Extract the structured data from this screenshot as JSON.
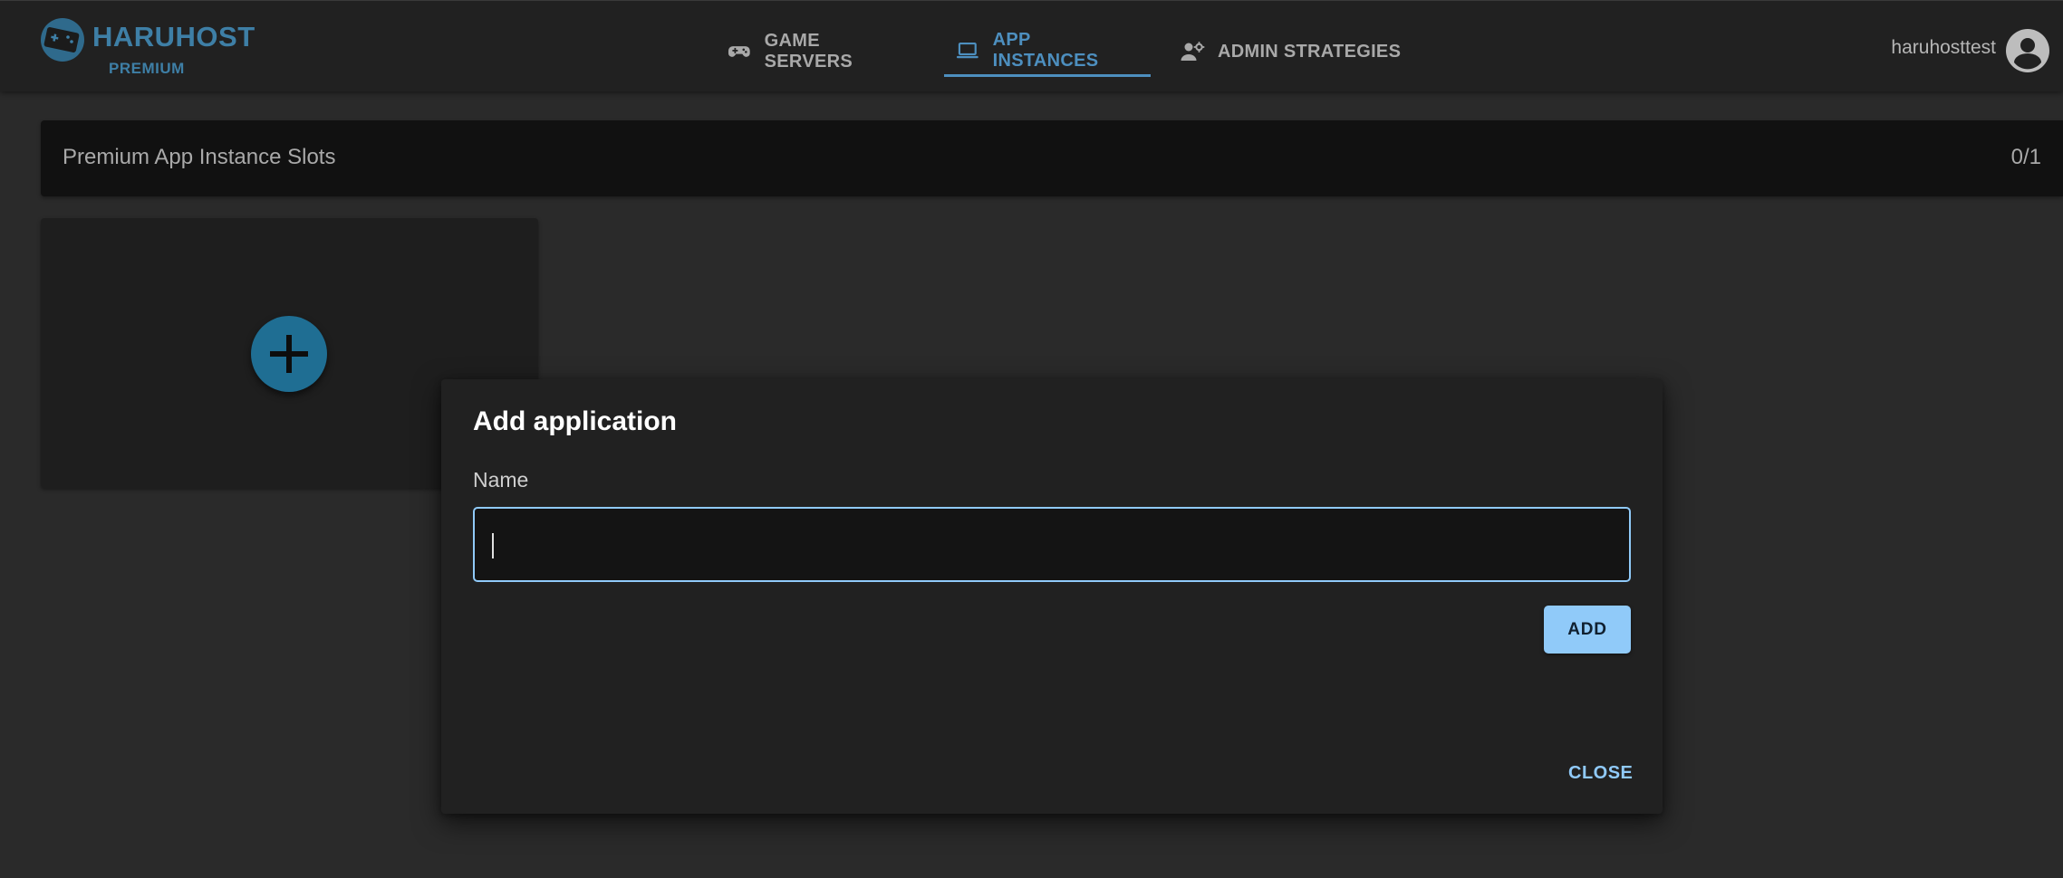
{
  "brand": {
    "name": "HARUHOST",
    "tier": "PREMIUM",
    "logo_icon": "gamepad-logo-icon",
    "color": "#3e7fa6"
  },
  "nav": {
    "tabs": [
      {
        "label": "GAME SERVERS",
        "icon": "gamepad-icon",
        "active": false
      },
      {
        "label": "APP INSTANCES",
        "icon": "laptop-icon",
        "active": true
      },
      {
        "label": "ADMIN STRATEGIES",
        "icon": "user-cog-icon",
        "active": false
      }
    ],
    "active_color": "#4d8fbf"
  },
  "user": {
    "name": "haruhosttest",
    "icon": "account-circle-icon"
  },
  "slots": {
    "title": "Premium App Instance Slots",
    "count": "0/1"
  },
  "add_card": {
    "icon": "plus-icon",
    "fab_color": "#1f6e93"
  },
  "dialog": {
    "title": "Add application",
    "name_label": "Name",
    "name_value": "",
    "add_label": "ADD",
    "close_label": "CLOSE",
    "accent": "#90caf9"
  }
}
